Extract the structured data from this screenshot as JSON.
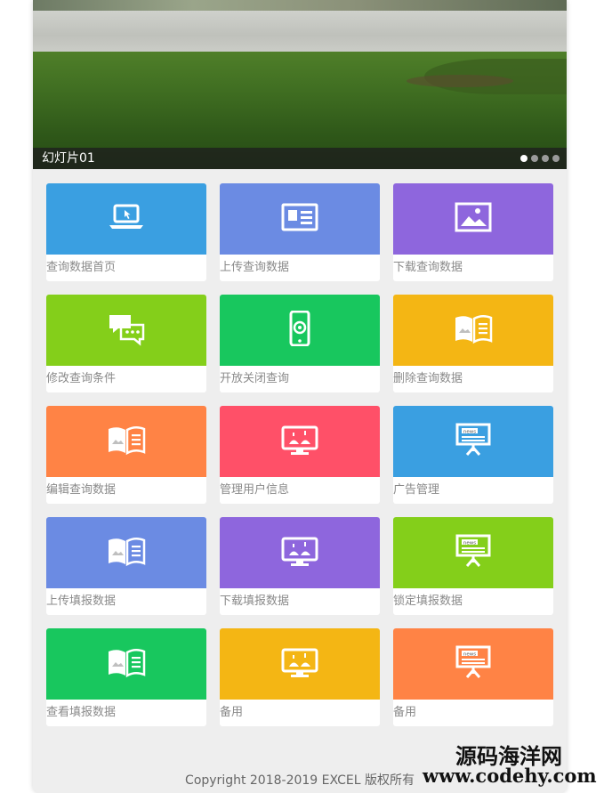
{
  "banner": {
    "caption": "幻灯片01",
    "dots": 4,
    "active_dot": 0
  },
  "tiles": [
    {
      "label": "查询数据首页",
      "color": "#3a9fe1",
      "icon": "laptop-icon"
    },
    {
      "label": "上传查询数据",
      "color": "#6b8be3",
      "icon": "id-card-icon"
    },
    {
      "label": "下载查询数据",
      "color": "#8e66dd",
      "icon": "image-icon"
    },
    {
      "label": "修改查询条件",
      "color": "#84cf1a",
      "icon": "chat-icon"
    },
    {
      "label": "开放关闭查询",
      "color": "#18c75e",
      "icon": "phone-icon"
    },
    {
      "label": "删除查询数据",
      "color": "#f4b614",
      "icon": "book-icon"
    },
    {
      "label": "编辑查询数据",
      "color": "#ff8345",
      "icon": "book-icon"
    },
    {
      "label": "管理用户信息",
      "color": "#ff5068",
      "icon": "monitor-icon"
    },
    {
      "label": "广告管理",
      "color": "#3a9fe1",
      "icon": "news-board-icon"
    },
    {
      "label": "上传填报数据",
      "color": "#6b8be3",
      "icon": "book-icon"
    },
    {
      "label": "下载填报数据",
      "color": "#8e66dd",
      "icon": "monitor-icon"
    },
    {
      "label": "锁定填报数据",
      "color": "#84cf1a",
      "icon": "news-board-icon"
    },
    {
      "label": "查看填报数据",
      "color": "#18c75e",
      "icon": "book-icon"
    },
    {
      "label": "备用",
      "color": "#f4b614",
      "icon": "monitor-icon"
    },
    {
      "label": "备用",
      "color": "#ff8345",
      "icon": "news-board-icon"
    }
  ],
  "footer": {
    "copyright": "Copyright 2018-2019 EXCEL 版权所有"
  },
  "watermark": {
    "site_name": "源码海洋网",
    "url": "www.codehy.com"
  }
}
